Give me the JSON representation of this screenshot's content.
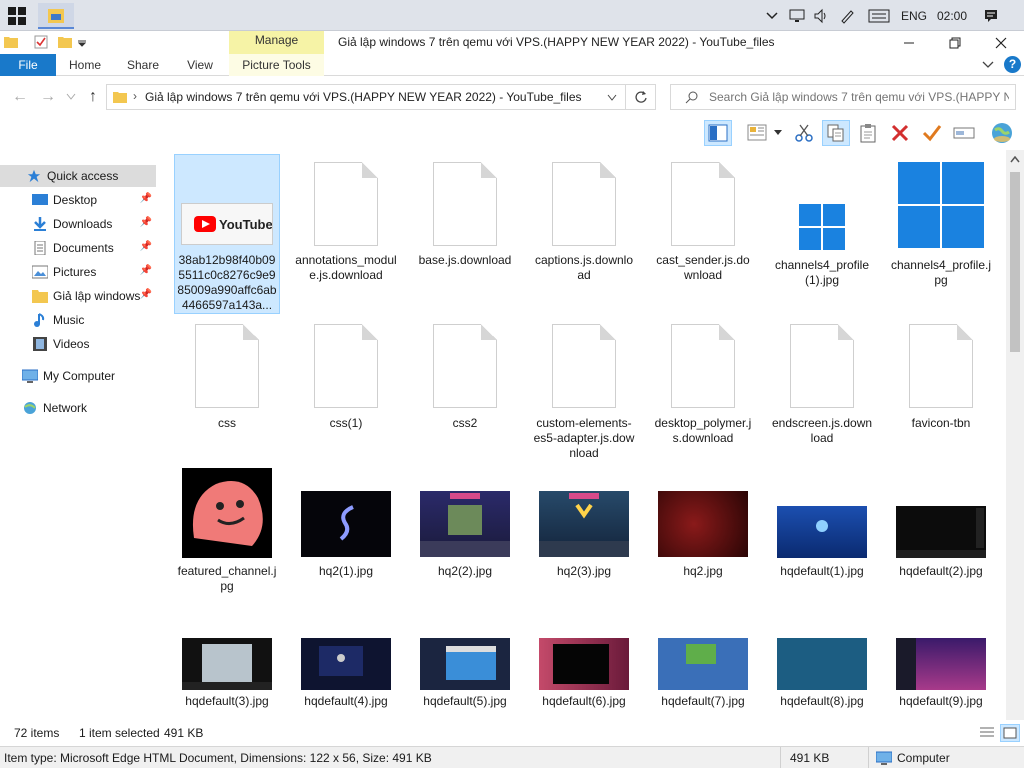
{
  "taskbar": {
    "language": "ENG",
    "clock": "02:00",
    "icons": [
      "windows-start-icon",
      "file-explorer-icon",
      "chevron-up-icon",
      "network-icon",
      "speaker-icon",
      "pen-icon",
      "keyboard-icon",
      "notification-icon"
    ]
  },
  "ribbon": {
    "manage_tab": "Manage",
    "window_title": "Giả lập windows 7 trên qemu với VPS.(HAPPY NEW YEAR 2022) - YouTube_files",
    "tabs": {
      "file": "File",
      "home": "Home",
      "share": "Share",
      "view": "View",
      "picture_tools": "Picture Tools"
    }
  },
  "address": {
    "path": "Giả lập windows 7 trên qemu với VPS.(HAPPY NEW YEAR 2022) - YouTube_files",
    "search_placeholder": "Search Giả lập windows 7 trên qemu với VPS.(HAPPY N..."
  },
  "sidebar": {
    "items": [
      {
        "label": "Quick access"
      },
      {
        "label": "Desktop"
      },
      {
        "label": "Downloads"
      },
      {
        "label": "Documents"
      },
      {
        "label": "Pictures"
      },
      {
        "label": "Giả lập windows"
      },
      {
        "label": "Music"
      },
      {
        "label": "Videos"
      },
      {
        "label": "My Computer"
      },
      {
        "label": "Network"
      }
    ]
  },
  "files": [
    {
      "name": "38ab12b98f40b095511c0c8276c9e985009a990affc6ab4466597a143a...",
      "kind": "youtube"
    },
    {
      "name": "annotations_module.js.download",
      "kind": "doc"
    },
    {
      "name": "base.js.download",
      "kind": "doc"
    },
    {
      "name": "captions.js.download",
      "kind": "doc"
    },
    {
      "name": "cast_sender.js.download",
      "kind": "doc"
    },
    {
      "name": "channels4_profile(1).jpg",
      "kind": "win-small"
    },
    {
      "name": "channels4_profile.jpg",
      "kind": "win-big"
    },
    {
      "name": "css",
      "kind": "doc"
    },
    {
      "name": "css(1)",
      "kind": "doc"
    },
    {
      "name": "css2",
      "kind": "doc"
    },
    {
      "name": "custom-elements-es5-adapter.js.download",
      "kind": "doc"
    },
    {
      "name": "desktop_polymer.js.download",
      "kind": "doc"
    },
    {
      "name": "endscreen.js.download",
      "kind": "doc"
    },
    {
      "name": "favicon-tbn",
      "kind": "doc"
    },
    {
      "name": "featured_channel.jpg",
      "kind": "blob"
    },
    {
      "name": "hq2(1).jpg",
      "kind": "dark-s"
    },
    {
      "name": "hq2(2).jpg",
      "kind": "poster"
    },
    {
      "name": "hq2(3).jpg",
      "kind": "poster"
    },
    {
      "name": "hq2.jpg",
      "kind": "red"
    },
    {
      "name": "hqdefault(1).jpg",
      "kind": "blue-win"
    },
    {
      "name": "hqdefault(2).jpg",
      "kind": "dark-desk"
    },
    {
      "name": "hqdefault(3).jpg",
      "kind": "dark-photo"
    },
    {
      "name": "hqdefault(4).jpg",
      "kind": "login"
    },
    {
      "name": "hqdefault(5).jpg",
      "kind": "win7"
    },
    {
      "name": "hqdefault(6).jpg",
      "kind": "pink"
    },
    {
      "name": "hqdefault(7).jpg",
      "kind": "green-desk"
    },
    {
      "name": "hqdefault(8).jpg",
      "kind": "teal"
    },
    {
      "name": "hqdefault(9).jpg",
      "kind": "purple"
    }
  ],
  "status": {
    "items_count": "72 items",
    "selected": "1 item selected",
    "selected_size": "491 KB",
    "item_type": "Item type: Microsoft Edge HTML Document, Dimensions: 122 x 56, Size: 491 KB",
    "size": "491 KB",
    "location": "Computer"
  },
  "colors": {
    "accent": "#1979ca",
    "selection": "#cde8ff",
    "manage": "#f6f3a6"
  }
}
